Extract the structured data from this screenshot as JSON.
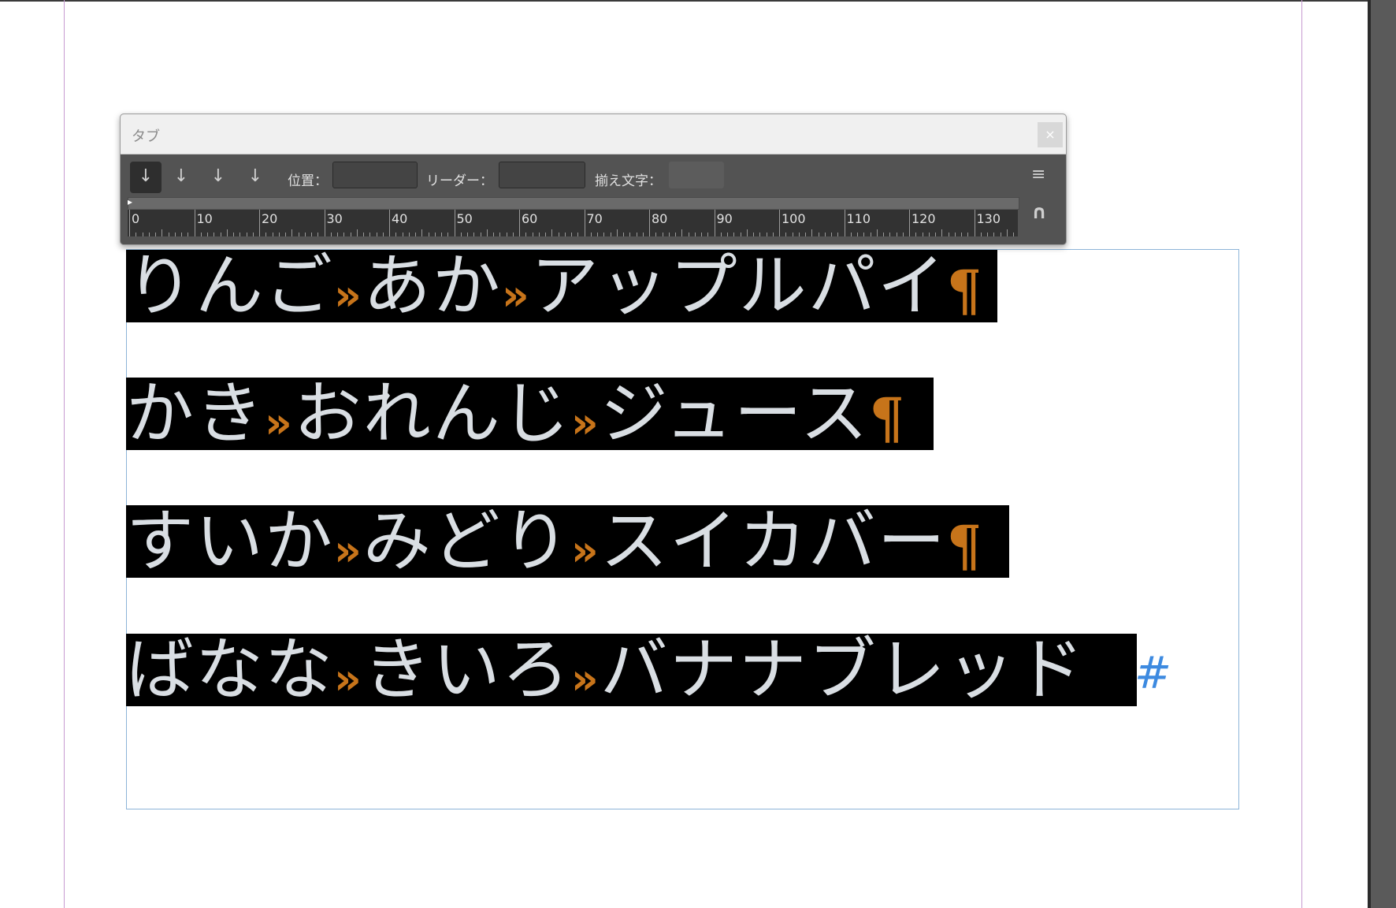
{
  "panel": {
    "title": "タブ",
    "close_label": "×",
    "tab_buttons": [
      "↓",
      "↓",
      "↓",
      "↓"
    ],
    "position_label": "位置：",
    "position_value": "",
    "leader_label": "リーダー：",
    "leader_value": "",
    "align_label": "揃え文字：",
    "align_value": "",
    "menu_icon": "≡",
    "magnet_icon": "∩",
    "ruler_labels": [
      "0",
      "10",
      "20",
      "30",
      "40",
      "50",
      "60",
      "70",
      "80",
      "90",
      "100",
      "110",
      "120",
      "130"
    ]
  },
  "document": {
    "lines": [
      {
        "parts": [
          "りんご",
          "あか",
          "アップルパイ"
        ],
        "end": "¶"
      },
      {
        "parts": [
          "かき",
          "おれんじ",
          "ジュース"
        ],
        "end": "¶"
      },
      {
        "parts": [
          "すいか",
          "みどり",
          "スイカバー"
        ],
        "end": "¶"
      },
      {
        "parts": [
          "ばなな",
          "きいろ",
          "バナナブレッド"
        ],
        "end": "#"
      }
    ],
    "tab_mark": "»"
  },
  "colors": {
    "highlight_bg": "#000000",
    "text": "#d9dee3",
    "hidden_char": "#c7741a",
    "end_of_story": "#3d8ae0",
    "frame_border": "#8db4d8"
  }
}
